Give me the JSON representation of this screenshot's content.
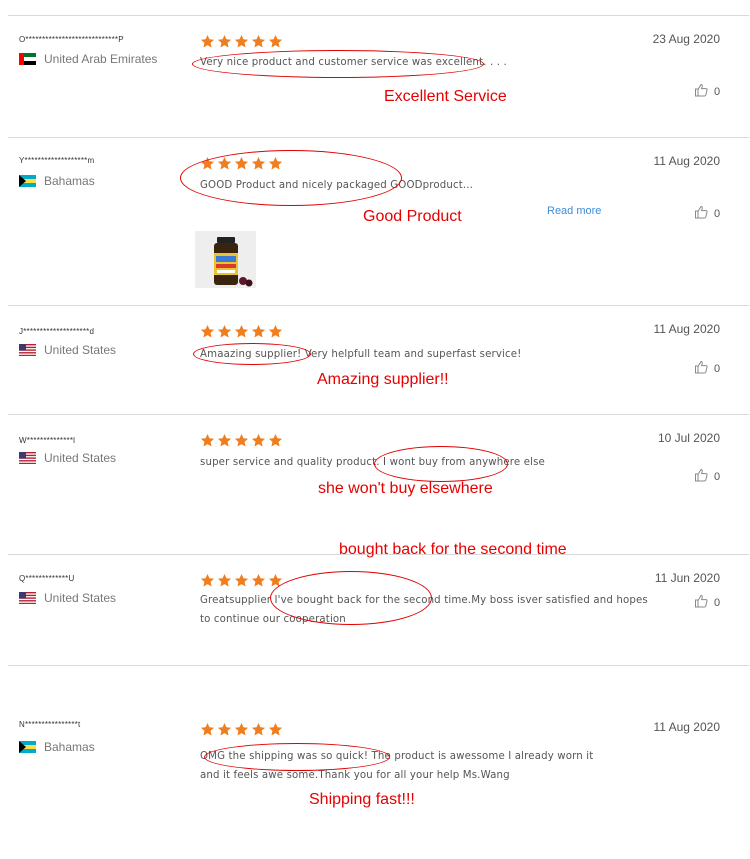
{
  "colors": {
    "star": "#f07d1e",
    "annotation": "#e60000",
    "link": "#3a8fd6"
  },
  "reviews": [
    {
      "username": "O****************************P",
      "country": "United Arab Emirates",
      "flag": "uae-flag-icon",
      "rating": 5,
      "text_lines": [
        "Very nice product and customer service was excellent.  . . ."
      ],
      "date": "23 Aug 2020",
      "likes": "0",
      "annotation": "Excellent Service"
    },
    {
      "username": "Y*******************m",
      "country": "Bahamas",
      "flag": "bahamas-flag-icon",
      "rating": 5,
      "text_lines": [
        "GOOD Product and nicely packaged      GOODproduct..."
      ],
      "read_more": "Read more",
      "date": "11 Aug 2020",
      "likes": "0",
      "annotation": "Good Product",
      "photo": "product-bottle-photo"
    },
    {
      "username": "J********************d",
      "country": "United States",
      "flag": "us-flag-icon",
      "rating": 5,
      "text_lines": [
        "Amaazing supplier! Very helpfull team and superfast service!"
      ],
      "date": "11 Aug 2020",
      "likes": "0",
      "annotation": "Amazing supplier!!"
    },
    {
      "username": "W**************l",
      "country": "United States",
      "flag": "us-flag-icon",
      "rating": 5,
      "text_lines": [
        "super service and quality product. I wont buy from anywhere else"
      ],
      "date": "10 Jul 2020",
      "likes": "0",
      "annotation": "she won't buy elsewhere"
    },
    {
      "username": "Q*************U",
      "country": "United States",
      "flag": "us-flag-icon",
      "rating": 5,
      "text_lines": [
        "Greatsupplier I've bought back for the second time.My boss isver satisfied and hopes",
        "to continue our cooperation"
      ],
      "date": "11 Jun 2020",
      "likes": "0",
      "annotation": "bought back for the second time"
    },
    {
      "username": "N****************t",
      "country": "Bahamas",
      "flag": "bahamas-flag-icon",
      "rating": 5,
      "text_lines": [
        "OMG the shipping was so quick! The product is awessome I already worn it",
        "and it feels awe some.Thank you for all your help Ms.Wang"
      ],
      "date": "11 Aug 2020",
      "likes": "0",
      "annotation": "Shipping fast!!!"
    }
  ]
}
